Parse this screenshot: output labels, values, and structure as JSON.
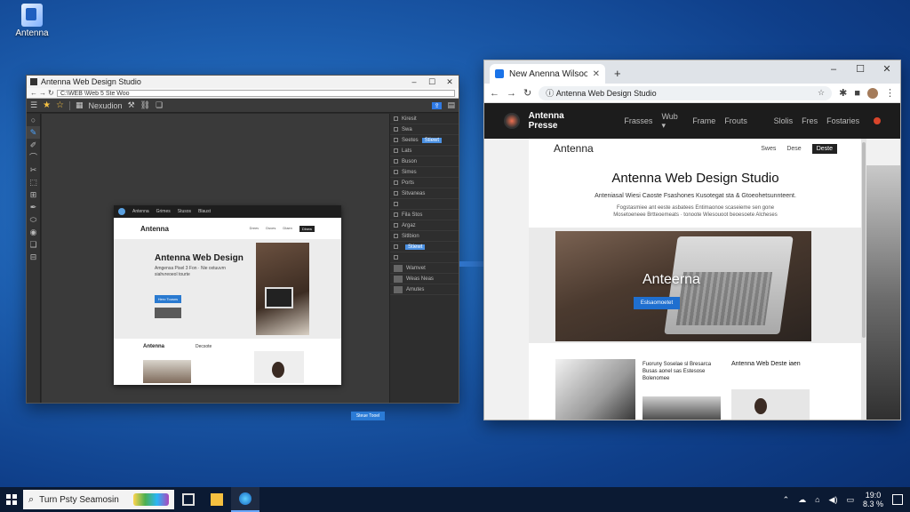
{
  "desktop": {
    "icons": [
      {
        "label": "Antenna",
        "icon": "app-icon"
      }
    ]
  },
  "editor": {
    "title": "Antenna Web Design Studio",
    "address": "C:\\WEB \\Web 5 Ste Woo",
    "toolbar_label": "Nexudion",
    "left_tools": [
      "○",
      "✎",
      "✐",
      "⌒",
      "✂",
      "⬚",
      "⊞",
      "✒",
      "⬭",
      "◉",
      "❑",
      "⊟"
    ],
    "right_panel": {
      "rows": [
        "Kiresit",
        "Swa",
        "Seetes",
        "Lats",
        "Buson",
        "Simes",
        "Ports",
        "Sitvaneas",
        "",
        "Fila Stos",
        "Argaz",
        "Sitlbion",
        "",
        "",
        "Wamvet",
        "Weas Neas",
        "Amutes"
      ],
      "button": "Stiewt"
    },
    "preview": {
      "nav": [
        "Antenna",
        "Grimes",
        "Stusos",
        "Blaust"
      ],
      "brand": "Antenna",
      "links": [
        "Dreev",
        "Dsves",
        "Dlaen",
        "Dlnew"
      ],
      "hero_title": "Antenna Web Design",
      "hero_sub": "Amgensa Pisel 3 Fon · Nie oxtuuvrn siahvreoeol tourte",
      "hero_button": "Hero Tousns",
      "section_left": "Antenna",
      "section_right": "Decsote"
    },
    "float_button": "Steue Tooel"
  },
  "browser": {
    "tab_title": "New Anenna Wilsoone",
    "address": "Antenna Web Design Studio",
    "site": {
      "nav_brand": "Antenna Presse",
      "nav_links": [
        "Frasses",
        "Wub ▾",
        "Frame",
        "Frouts",
        "Slolis",
        "Fres",
        "Fostaries"
      ],
      "brand": "Antenna",
      "links": [
        "Swes",
        "Dese",
        "Deste"
      ],
      "title": "Antenna Web Design Studio",
      "tagline": "Anteniasal Wiesi Caoste Fsashones Kusotegat sta & Gtoeohetsunnteent.",
      "desc": "Fogstasmiee ant eeste asbatees Entimaonoe scaseieme sen gone Mosetoeneee Brtteoemeats · tonoote Wiesouoot beoesoete Alcheses",
      "hero_title": "Anteerna",
      "hero_button": "Eslsaomoetet",
      "card1": "Fuoruny Soselae sl Bresarca Busas aonel sas Estesose Bolenomee",
      "card2": "Antenna Web Deste iaen"
    }
  },
  "taskbar": {
    "search_text": "Turn Psty Seamosin",
    "apps": [
      "task-view-icon",
      "file-explorer-icon",
      "edge-icon"
    ],
    "clock_time": "19:0",
    "clock_date": "8.3 %"
  },
  "colors": {
    "accent": "#2f7ae5",
    "desktop": "#1d5fb0",
    "taskbar": "#0b1a33"
  }
}
